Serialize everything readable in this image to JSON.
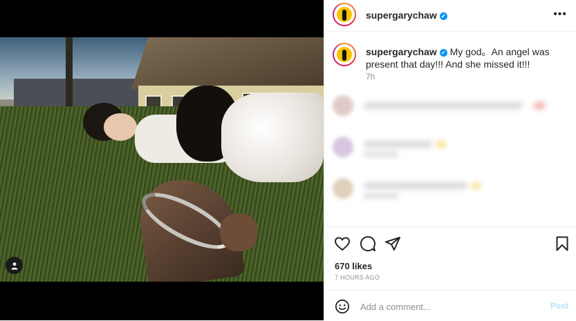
{
  "post": {
    "username": "supergarychaw",
    "verified_icon": "✔",
    "more_icon": "•••",
    "caption": "My god。An angel was present that day!!! And she missed it!!!",
    "time_ago": "7h",
    "likes": "670 likes",
    "posted": "7 HOURS AGO"
  },
  "comment": {
    "placeholder": "Add a comment...",
    "post_label": "Post"
  },
  "colors": {
    "verified": "#0095f6",
    "post_disabled": "#b2dffc",
    "muted": "#8e8e8e"
  },
  "icons": [
    "heart-icon",
    "comment-icon",
    "share-icon",
    "bookmark-icon",
    "emoji-icon",
    "user-tag-icon",
    "more-icon",
    "verified-icon"
  ]
}
